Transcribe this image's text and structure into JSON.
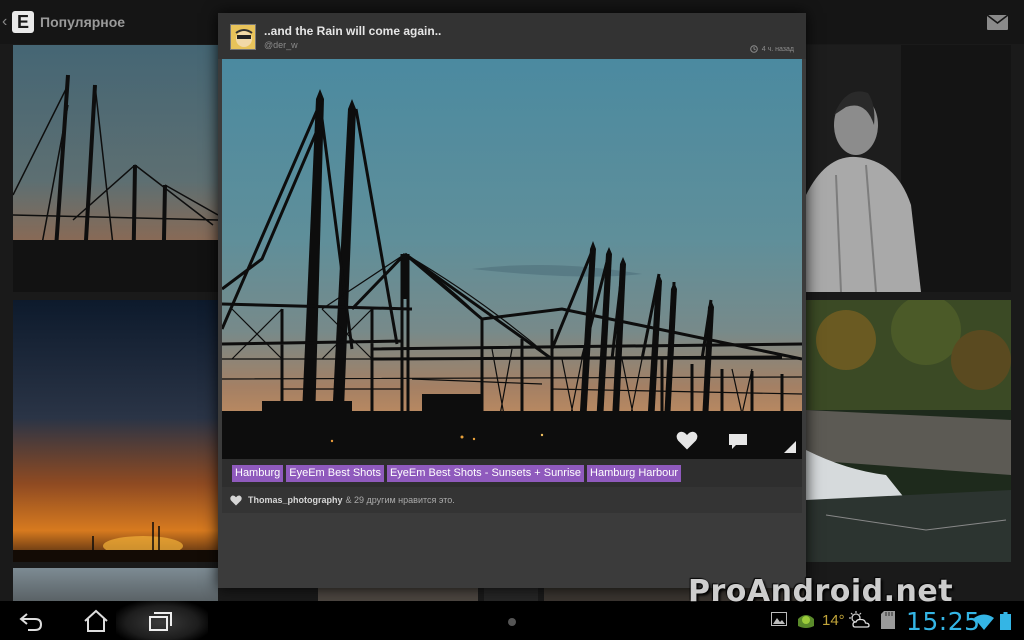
{
  "app": {
    "title": "Популярное",
    "logo_letter": "E"
  },
  "photo": {
    "title": "..and the Rain will come again..",
    "author": "@der_w",
    "time": "4 ч. назад"
  },
  "tags": [
    "Hamburg",
    "EyeEm Best Shots",
    "EyeEm Best Shots - Sunsets + Sunrise",
    "Hamburg Harbour"
  ],
  "likes": {
    "user": "Thomas_photography",
    "rest": "& 29 другим нравится это."
  },
  "status_bar": {
    "temperature": "14°",
    "time": "15:25"
  },
  "watermark": "ProAndroid.net",
  "icons": {
    "actionbar": [
      "back-icon",
      "mail-icon"
    ],
    "photo_actions": [
      "heart-icon",
      "comment-icon"
    ],
    "system": [
      "back-nav-icon",
      "home-nav-icon",
      "recents-nav-icon",
      "gallery-icon",
      "android-icon",
      "weather-icon",
      "sd-card-icon",
      "wifi-icon",
      "battery-icon"
    ]
  },
  "colors": {
    "accent_tag": "#8f5abd",
    "clock": "#34b5e5",
    "temperature": "#c2a53a"
  }
}
